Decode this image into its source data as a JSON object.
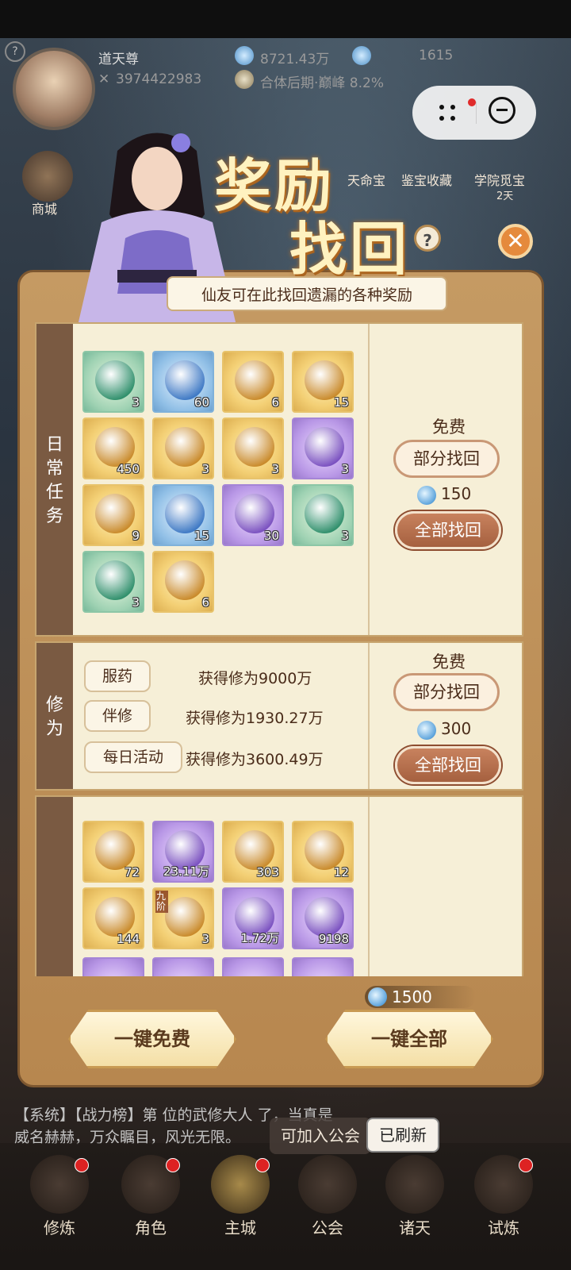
{
  "header": {
    "player_name": "道天尊",
    "power": "3974422983",
    "currency": "8721.43万",
    "gem_count": "1615",
    "realm": "合体后期·巅峰 8.2%"
  },
  "side": {
    "left_label": "商城",
    "right_labels": [
      "天命宝",
      "鉴宝收藏",
      "学院觅宝"
    ],
    "right_sub": "2天"
  },
  "popup": {
    "title_line1": "奖励",
    "title_line2": "找回",
    "subtitle": "仙友可在此找回遗漏的各种奖励",
    "help": "?",
    "close": "✕"
  },
  "daily": {
    "label": "日常任务",
    "items": [
      {
        "name": "scroll-red-icon",
        "count": "3",
        "color": "green"
      },
      {
        "name": "spirit-flame-icon",
        "count": "60",
        "color": "blue"
      },
      {
        "name": "paper-scroll-icon",
        "count": "6",
        "color": "gold"
      },
      {
        "name": "blue-potion-icon",
        "count": "15",
        "color": "gold"
      },
      {
        "name": "dragon-jade-icon",
        "count": "450",
        "color": "gold"
      },
      {
        "name": "spell-card-icon",
        "count": "3",
        "color": "gold"
      },
      {
        "name": "golden-cauldron-icon",
        "count": "3",
        "color": "gold"
      },
      {
        "name": "silk-scroll-icon",
        "count": "3",
        "color": "purple"
      },
      {
        "name": "ancient-book-icon",
        "count": "9",
        "color": "gold"
      },
      {
        "name": "crystal-orb-icon",
        "count": "15",
        "color": "blue"
      },
      {
        "name": "lightning-orb-icon",
        "count": "30",
        "color": "purple"
      },
      {
        "name": "green-scroll-icon",
        "count": "3",
        "color": "green"
      },
      {
        "name": "blue-scroll-icon",
        "count": "3",
        "color": "green"
      },
      {
        "name": "manual-book-icon",
        "count": "6",
        "color": "gold"
      }
    ],
    "free": "免费",
    "part_btn": "部分找回",
    "cost": "150",
    "all_btn": "全部找回"
  },
  "xiuwei": {
    "label": "修为",
    "rows": [
      {
        "tag": "服药",
        "text": "获得修为9000万"
      },
      {
        "tag": "伴修",
        "text": "获得修为1930.27万"
      },
      {
        "tag": "每日活动",
        "text": "获得修为3600.49万"
      }
    ],
    "free": "免费",
    "part_btn": "部分找回",
    "cost": "300",
    "all_btn": "全部找回"
  },
  "third": {
    "items": [
      {
        "name": "purple-potion-icon",
        "count": "72",
        "color": "gold"
      },
      {
        "name": "green-crystal-icon",
        "count": "23.11万",
        "color": "purple"
      },
      {
        "name": "blue-flask-icon",
        "count": "303",
        "color": "gold"
      },
      {
        "name": "pomegranate-icon",
        "count": "12",
        "color": "gold"
      },
      {
        "name": "stone-egg-icon",
        "count": "144",
        "color": "gold"
      },
      {
        "name": "rainbow-orb-icon",
        "count": "3",
        "color": "gold",
        "tag": "九阶"
      },
      {
        "name": "spirit-herb-icon",
        "count": "1.72万",
        "color": "purple"
      },
      {
        "name": "amber-ore-icon",
        "count": "9198",
        "color": "purple"
      }
    ]
  },
  "footer": {
    "total_cost": "1500",
    "btn_free": "一键免费",
    "btn_all": "一键全部"
  },
  "chat": {
    "line2": "【系统】【战力榜】第  位的武修大人            了，当真是",
    "line3": "威名赫赫，万众瞩目，风光无限。"
  },
  "nav": [
    "修炼",
    "角色",
    "主城",
    "公会",
    "诸天",
    "试炼"
  ],
  "toast": {
    "join": "可加入公会",
    "refreshed": "已刷新"
  }
}
